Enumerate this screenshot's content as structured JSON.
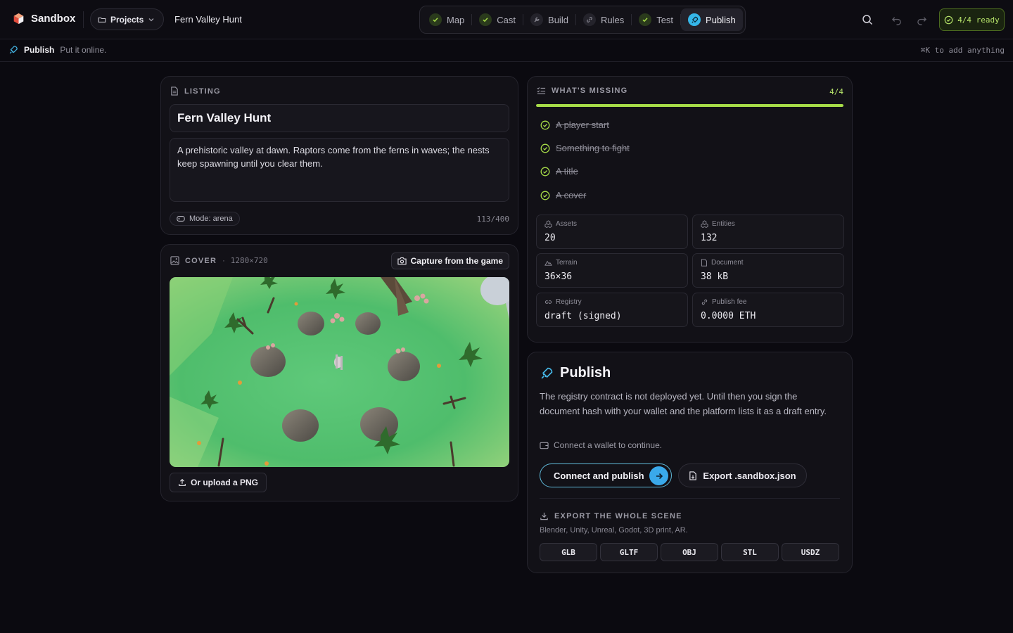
{
  "app": {
    "name": "Sandbox",
    "projects_label": "Projects",
    "project_title": "Fern Valley Hunt"
  },
  "steps": [
    {
      "label": "Map",
      "state": "done",
      "icon": "check-icon"
    },
    {
      "label": "Cast",
      "state": "done",
      "icon": "check-icon"
    },
    {
      "label": "Build",
      "state": "todo",
      "icon": "wrench-icon"
    },
    {
      "label": "Rules",
      "state": "todo",
      "icon": "link-icon"
    },
    {
      "label": "Test",
      "state": "done",
      "icon": "check-icon"
    },
    {
      "label": "Publish",
      "state": "active",
      "icon": "rocket-icon"
    }
  ],
  "status": {
    "ready_label": "4/4 ready"
  },
  "subbar": {
    "title": "Publish",
    "desc": "Put it online.",
    "hint": "⌘K to add anything"
  },
  "listing": {
    "heading": "LISTING",
    "title": "Fern Valley Hunt",
    "description": "A prehistoric valley at dawn. Raptors come from the ferns in waves; the nests keep spawning until you clear them.",
    "mode_label": "Mode: arena",
    "counter": "113/400"
  },
  "cover": {
    "heading": "COVER",
    "size": "1280×720",
    "capture_label": "Capture from the game",
    "upload_label": "Or upload a PNG"
  },
  "missing": {
    "heading": "WHAT'S MISSING",
    "fraction": "4/4",
    "progress": 1.0,
    "items": [
      "A player start",
      "Something to fight",
      "A title",
      "A cover"
    ],
    "stats": [
      {
        "label": "Assets",
        "value": "20",
        "icon": "assets-icon"
      },
      {
        "label": "Entities",
        "value": "132",
        "icon": "entities-icon"
      },
      {
        "label": "Terrain",
        "value": "36×36",
        "icon": "terrain-icon"
      },
      {
        "label": "Document",
        "value": "38 kB",
        "icon": "document-icon"
      },
      {
        "label": "Registry",
        "value": "draft (signed)",
        "icon": "link-icon"
      },
      {
        "label": "Publish fee",
        "value": "0.0000 ETH",
        "icon": "link-icon"
      }
    ]
  },
  "publish": {
    "title": "Publish",
    "body": "The registry contract is not deployed yet. Until then you sign the document hash with your wallet and the platform lists it as a draft entry.",
    "wallet_note": "Connect a wallet to continue.",
    "connect_label": "Connect and publish",
    "export_label": "Export .sandbox.json",
    "scene_heading": "EXPORT THE WHOLE SCENE",
    "scene_sub": "Blender, Unity, Unreal, Godot, 3D print, AR.",
    "formats": [
      "GLB",
      "GLTF",
      "OBJ",
      "STL",
      "USDZ"
    ]
  },
  "colors": {
    "accent_green": "#a7dc48",
    "accent_blue": "#3aa9ea",
    "background": "#0b0a10"
  }
}
